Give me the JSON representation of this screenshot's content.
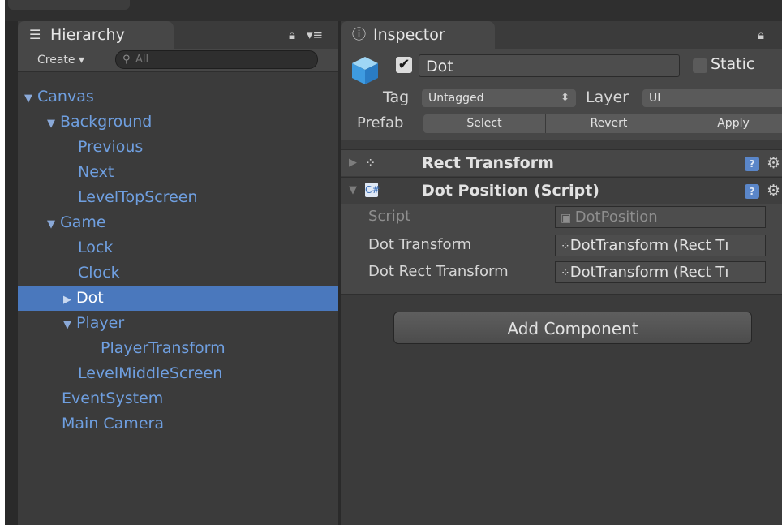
{
  "hierarchy": {
    "tab_icon": "list-icon",
    "tab_label": "Hierarchy",
    "create_label": "Create ▾",
    "search_placeholder": "All",
    "items": [
      {
        "label": "Canvas",
        "arrow": "▼",
        "depth": 0,
        "selected": false
      },
      {
        "label": "Background",
        "arrow": "▼",
        "depth": 1,
        "selected": false
      },
      {
        "label": "Previous",
        "arrow": "",
        "depth": 2,
        "selected": false
      },
      {
        "label": "Next",
        "arrow": "",
        "depth": 2,
        "selected": false
      },
      {
        "label": "LevelTopScreen",
        "arrow": "",
        "depth": 2,
        "selected": false
      },
      {
        "label": "Game",
        "arrow": "▼",
        "depth": 1,
        "selected": false
      },
      {
        "label": "Lock",
        "arrow": "",
        "depth": 2,
        "selected": false
      },
      {
        "label": "Clock",
        "arrow": "",
        "depth": 2,
        "selected": false
      },
      {
        "label": "Dot",
        "arrow": "▶",
        "depth": 2,
        "selected": true
      },
      {
        "label": "Player",
        "arrow": "▼",
        "depth": 2,
        "selected": false
      },
      {
        "label": "PlayerTransform",
        "arrow": "",
        "depth": 3,
        "selected": false
      },
      {
        "label": "LevelMiddleScreen",
        "arrow": "",
        "depth": 2,
        "selected": false
      },
      {
        "label": "EventSystem",
        "arrow": "",
        "depth": 1,
        "selected": false
      },
      {
        "label": "Main Camera",
        "arrow": "",
        "depth": 1,
        "selected": false
      }
    ]
  },
  "inspector": {
    "tab_icon": "info-icon",
    "tab_label": "Inspector",
    "object_name": "Dot",
    "active": true,
    "static_label": "Static",
    "tag_label": "Tag",
    "tag_value": "Untagged",
    "layer_label": "Layer",
    "layer_value": "UI",
    "prefab_label": "Prefab",
    "prefab_select": "Select",
    "prefab_revert": "Revert",
    "prefab_apply": "Apply",
    "components": [
      {
        "name": "Rect Transform",
        "icon": "rect-transform-icon",
        "expanded": false
      },
      {
        "name": "Dot Position (Script)",
        "icon": "script-icon",
        "expanded": true
      }
    ],
    "script_props": {
      "script_label": "Script",
      "script_value": "DotPosition",
      "dot_transform_label": "Dot Transform",
      "dot_transform_value": "DotTransform (Rect Tı",
      "dot_rect_label": "Dot Rect Transform",
      "dot_rect_value": "DotTransform (Rect Tı"
    },
    "add_component_label": "Add Component"
  },
  "colors": {
    "hierarchy_text": "#6f9fe0",
    "selection": "#4a78bd",
    "panel_bg": "#3b3b3b"
  }
}
